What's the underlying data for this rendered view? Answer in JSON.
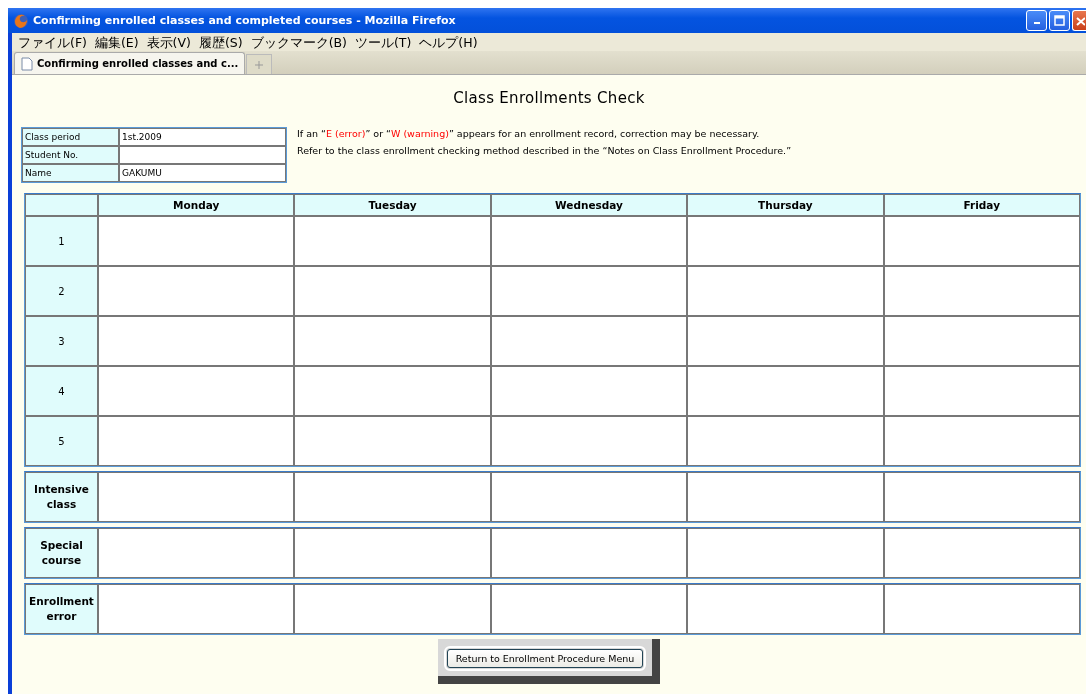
{
  "window": {
    "title": "Confirming enrolled classes and completed courses - Mozilla Firefox"
  },
  "menu": [
    "ファイル(F)",
    "編集(E)",
    "表示(V)",
    "履歴(S)",
    "ブックマーク(B)",
    "ツール(T)",
    "ヘルプ(H)"
  ],
  "tabs": [
    {
      "label": "Confirming enrolled classes and c...",
      "selected": true
    }
  ],
  "page_title": "Class Enrollments Check",
  "info": [
    {
      "label": "Class period",
      "value": "1st.2009"
    },
    {
      "label": "Student No."
    },
    {
      "label": "Name",
      "value": "GAKUMU"
    }
  ],
  "notice": [
    [
      {
        "text": "If an “",
        "emphasis": false
      },
      {
        "text": "E (error)",
        "emphasis": true
      },
      {
        "text": "” or “",
        "emphasis": false
      },
      {
        "text": "W (warning)",
        "emphasis": true
      },
      {
        "text": "” appears for an enrollment record, correction may be necessary.",
        "emphasis": false
      }
    ],
    [
      {
        "text": "Refer to the class enrollment checking method described in the “Notes on Class Enrollment Procedure.”",
        "emphasis": false
      }
    ]
  ],
  "schedule": {
    "columns": [
      "Monday",
      "Tuesday",
      "Wednesday",
      "Thursday",
      "Friday"
    ],
    "periods": [
      "1",
      "2",
      "3",
      "4",
      "5"
    ],
    "extra_rows": [
      "Intensive class",
      "Special course",
      "Enrollment error"
    ]
  },
  "button": "Return to Enrollment Procedure Menu"
}
